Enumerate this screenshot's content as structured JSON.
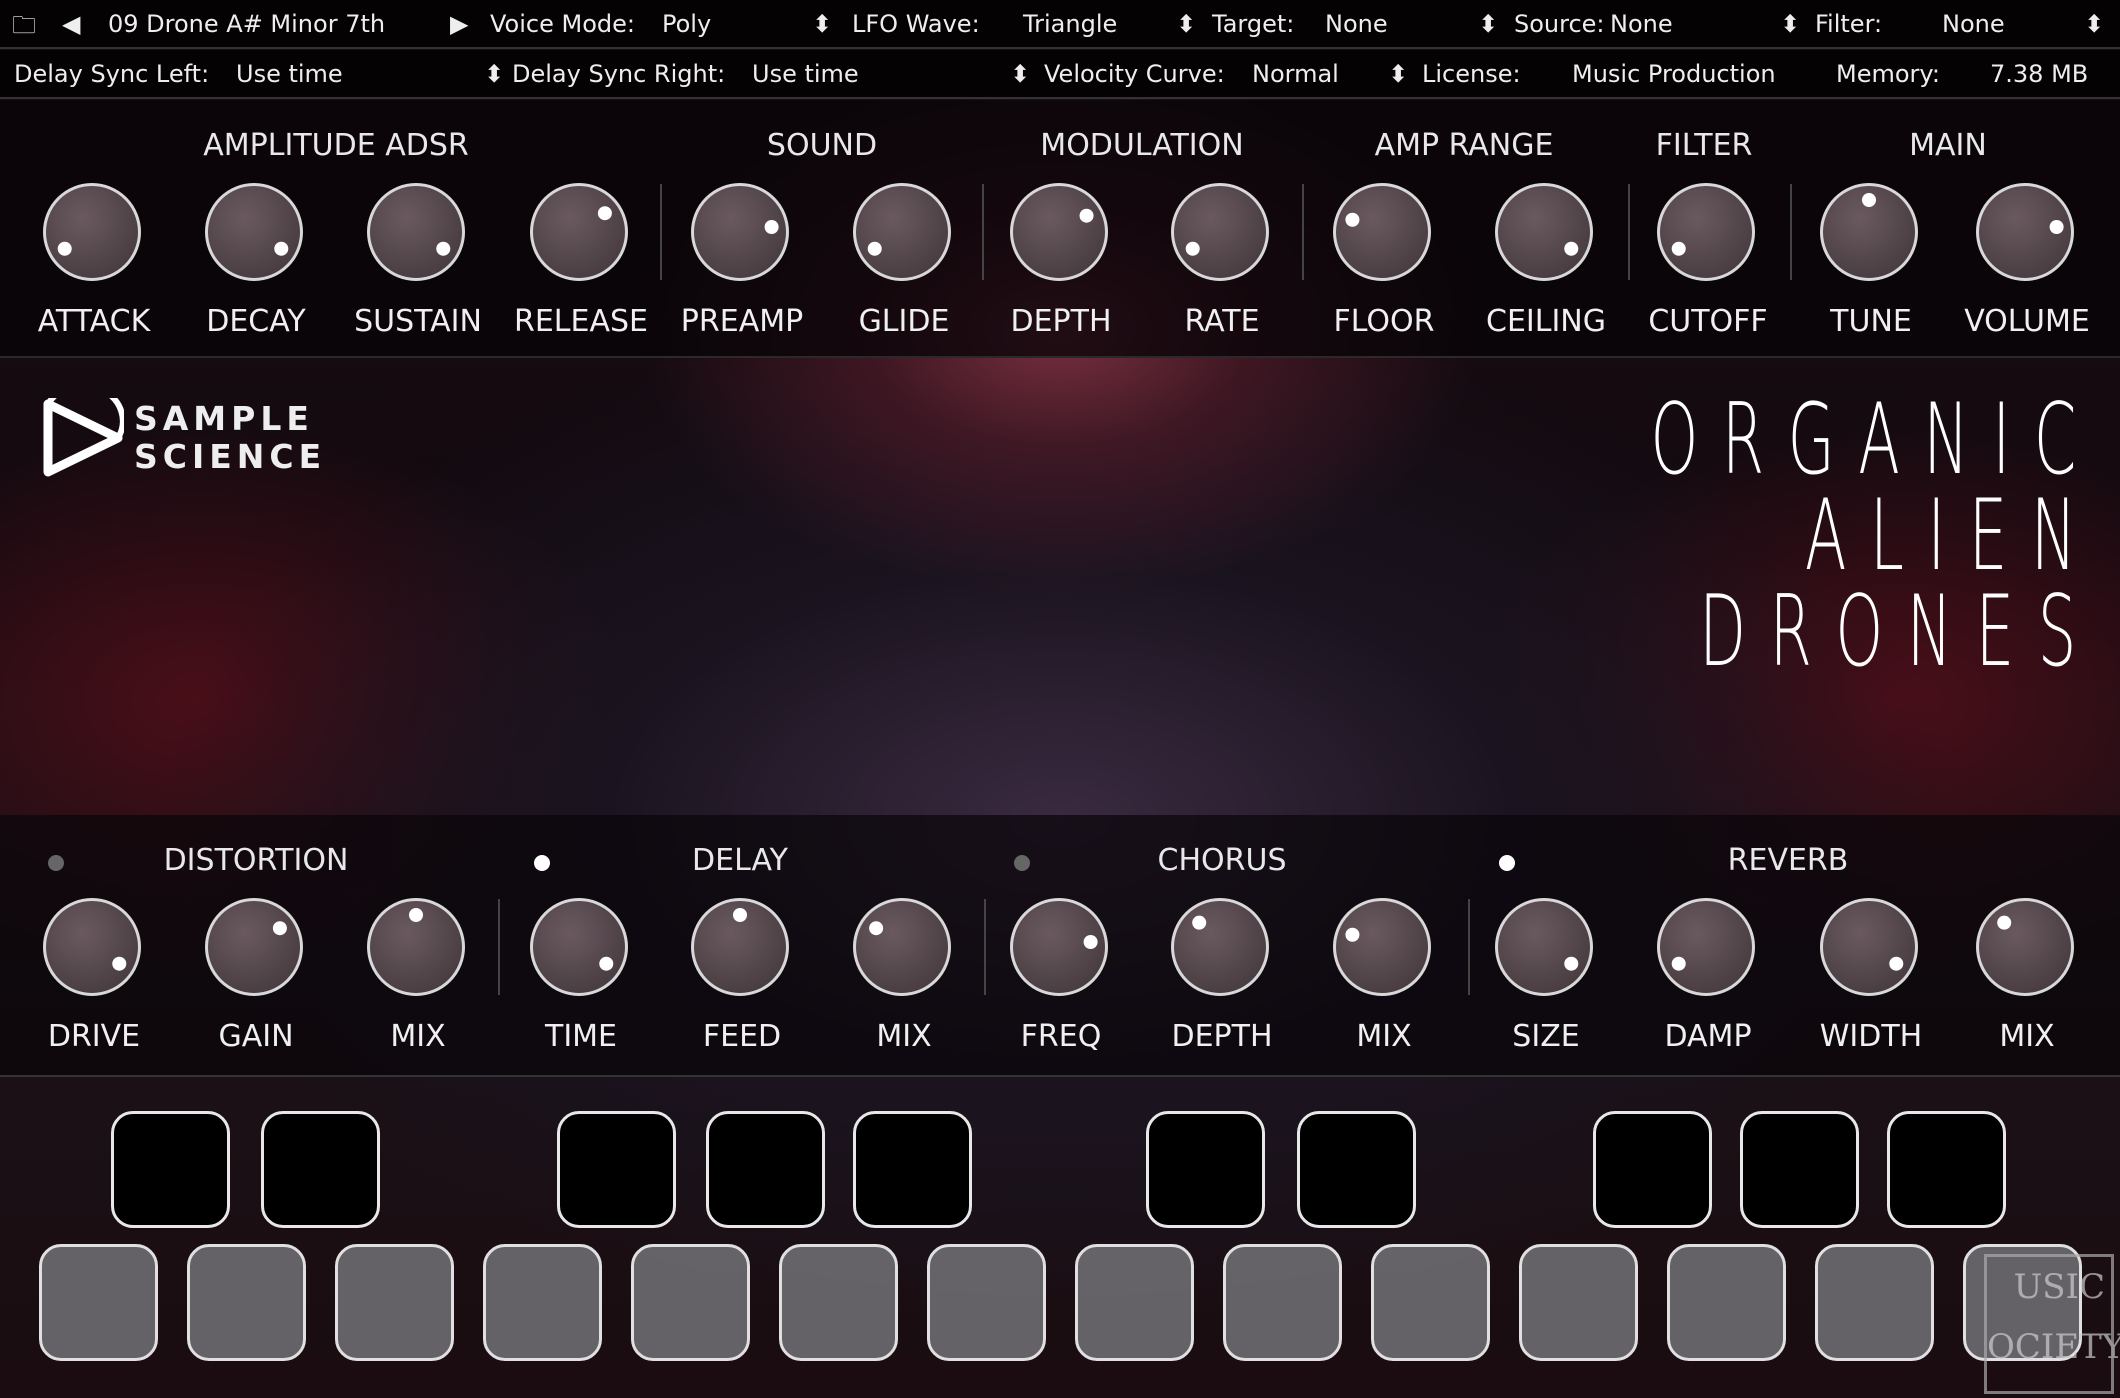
{
  "header": {
    "preset": "09 Drone A# Minor 7th",
    "voice_mode_label": "Voice Mode:",
    "voice_mode": "Poly",
    "lfo_wave_label": "LFO Wave:",
    "lfo_wave": "Triangle",
    "target_label": "Target:",
    "target": "None",
    "source_label": "Source:",
    "source": "None",
    "filter_label": "Filter:",
    "filter": "None"
  },
  "header2": {
    "delay_left_label": "Delay Sync Left:",
    "delay_left": "Use time",
    "delay_right_label": "Delay Sync Right:",
    "delay_right": "Use time",
    "velocity_label": "Velocity Curve:",
    "velocity": "Normal",
    "license_label": "License:",
    "license": "Music Production",
    "memory_label": "Memory:",
    "memory": "7.38 MB"
  },
  "top_sections": [
    "AMPLITUDE ADSR",
    "SOUND",
    "MODULATION",
    "AMP RANGE",
    "FILTER",
    "MAIN"
  ],
  "top_knobs": [
    {
      "label": "ATTACK",
      "value": 0.05
    },
    {
      "label": "DECAY",
      "value": 0.95
    },
    {
      "label": "SUSTAIN",
      "value": 0.95
    },
    {
      "label": "RELEASE",
      "value": 0.7
    },
    {
      "label": "PREAMP",
      "value": 0.8
    },
    {
      "label": "GLIDE",
      "value": 0.05
    },
    {
      "label": "DEPTH",
      "value": 0.72
    },
    {
      "label": "RATE",
      "value": 0.05
    },
    {
      "label": "FLOOR",
      "value": 0.25
    },
    {
      "label": "CEILING",
      "value": 0.95
    },
    {
      "label": "CUTOFF",
      "value": 0.05
    },
    {
      "label": "TUNE",
      "value": 0.5
    },
    {
      "label": "VOLUME",
      "value": 0.8
    }
  ],
  "fx_sections": [
    {
      "label": "DISTORTION",
      "enabled": false
    },
    {
      "label": "DELAY",
      "enabled": true
    },
    {
      "label": "CHORUS",
      "enabled": false
    },
    {
      "label": "REVERB",
      "enabled": true
    }
  ],
  "fx_knobs": [
    {
      "label": "DRIVE",
      "value": 0.95
    },
    {
      "label": "GAIN",
      "value": 0.7
    },
    {
      "label": "MIX",
      "value": 0.5
    },
    {
      "label": "TIME",
      "value": 0.95
    },
    {
      "label": "FEED",
      "value": 0.5
    },
    {
      "label": "MIX",
      "value": 0.3
    },
    {
      "label": "FREQ",
      "value": 0.8
    },
    {
      "label": "DEPTH",
      "value": 0.35
    },
    {
      "label": "MIX",
      "value": 0.25
    },
    {
      "label": "SIZE",
      "value": 0.95
    },
    {
      "label": "DAMP",
      "value": 0.05
    },
    {
      "label": "WIDTH",
      "value": 0.95
    },
    {
      "label": "MIX",
      "value": 0.35
    }
  ],
  "brand": {
    "logo": "SAMPLE SCIENCE",
    "title_lines": [
      "ORGANIC",
      "ALIEN",
      "DRONES"
    ],
    "watermark": "MUSIC SOCIETY"
  },
  "colors": {
    "led_on": "#ffffff",
    "led_off": "#666666"
  }
}
